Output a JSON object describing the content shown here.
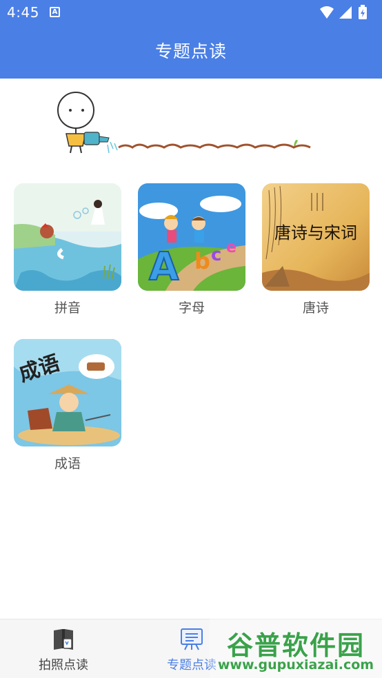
{
  "status_bar": {
    "time": "4:45",
    "notification_icon": "a-box-icon",
    "icons": [
      "wifi-icon",
      "signal-icon",
      "battery-icon"
    ]
  },
  "app_bar": {
    "title": "专题点读"
  },
  "topics": [
    {
      "label": "拼音"
    },
    {
      "label": "字母"
    },
    {
      "label": "唐诗",
      "thumb_text": "唐诗与宋词"
    },
    {
      "label": "成语",
      "thumb_text": "成语"
    }
  ],
  "bottom_nav": {
    "items": [
      {
        "label": "拍照点读",
        "icon": "book-photo-icon",
        "active": false
      },
      {
        "label": "专题点读",
        "icon": "topic-board-icon",
        "active": true
      }
    ]
  },
  "watermark": {
    "title": "谷普软件园",
    "url": "www.gupuxiazai.com"
  },
  "colors": {
    "primary": "#4a7fe5",
    "label": "#555555",
    "nav_bg": "#f6f6f6"
  }
}
